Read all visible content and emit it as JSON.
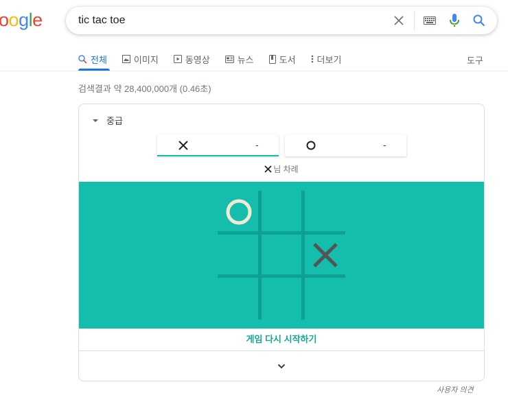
{
  "logo": {
    "letters": [
      {
        "ch": "o",
        "color": "#EA4335"
      },
      {
        "ch": "o",
        "color": "#FBBC05"
      },
      {
        "ch": "g",
        "color": "#4285F4"
      },
      {
        "ch": "l",
        "color": "#34A853"
      },
      {
        "ch": "e",
        "color": "#EA4335"
      }
    ]
  },
  "search": {
    "query": "tic tac toe",
    "icons": [
      "close-icon",
      "keyboard-icon",
      "microphone-icon",
      "search-icon"
    ]
  },
  "tabs": [
    {
      "label": "전체",
      "icon": "search-icon",
      "active": true
    },
    {
      "label": "이미지",
      "icon": "image-icon",
      "active": false
    },
    {
      "label": "동영상",
      "icon": "video-icon",
      "active": false
    },
    {
      "label": "뉴스",
      "icon": "news-icon",
      "active": false
    },
    {
      "label": "도서",
      "icon": "book-icon",
      "active": false
    },
    {
      "label": "더보기",
      "icon": "more-vert-icon",
      "active": false
    }
  ],
  "tools_label": "도구",
  "result_stats": "검색결과 약 28,400,000개 (0.46초)",
  "game": {
    "difficulty": "중급",
    "players": [
      {
        "symbol": "X",
        "score": "-",
        "active": true
      },
      {
        "symbol": "O",
        "score": "-",
        "active": false
      }
    ],
    "turn_text": "님 차례",
    "board": [
      "O",
      "",
      "",
      "",
      "",
      "X",
      "",
      "",
      ""
    ],
    "restart_label": "게임 다시 시작하기"
  },
  "feedback_label": "사용자 의견",
  "colors": {
    "accent": "#1a73e8",
    "board_bg": "#14bdac",
    "grid": "#0da192",
    "o_mark": "#f2ebd3",
    "x_mark": "#545454",
    "restart": "#14a594"
  }
}
